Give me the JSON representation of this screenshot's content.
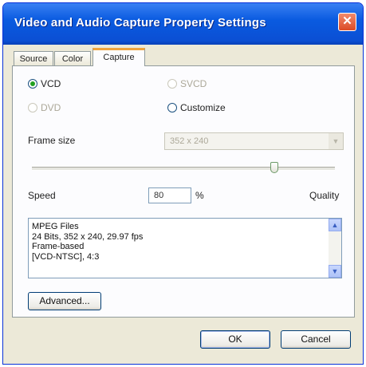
{
  "window": {
    "title": "Video and Audio Capture Property Settings",
    "close_glyph": "✕"
  },
  "tabs": [
    {
      "label": "Source",
      "active": false
    },
    {
      "label": "Color",
      "active": false
    },
    {
      "label": "Capture",
      "active": true
    }
  ],
  "capture": {
    "format_options": [
      {
        "label": "VCD",
        "checked": true,
        "enabled": true
      },
      {
        "label": "SVCD",
        "checked": false,
        "enabled": false
      },
      {
        "label": "DVD",
        "checked": false,
        "enabled": false
      },
      {
        "label": "Customize",
        "checked": false,
        "enabled": true
      }
    ],
    "frame_size_label": "Frame size",
    "frame_size_value": "352 x 240",
    "dropdown_arrow": "▼",
    "slider_position_percent": 80,
    "speed_label": "Speed",
    "speed_value": "80",
    "percent_unit": "%",
    "quality_label": "Quality",
    "info_lines": [
      "MPEG Files",
      "24 Bits, 352 x 240, 29.97 fps",
      "Frame-based",
      "[VCD-NTSC], 4:3"
    ],
    "scroll_up": "▲",
    "scroll_down": "▼",
    "advanced_label": "Advanced..."
  },
  "footer": {
    "ok_label": "OK",
    "cancel_label": "Cancel"
  },
  "colors": {
    "titlebar": "#0a5be0",
    "close": "#dc4a25",
    "active_tab_accent": "#f0a33b",
    "radio_checked": "#21a121"
  }
}
